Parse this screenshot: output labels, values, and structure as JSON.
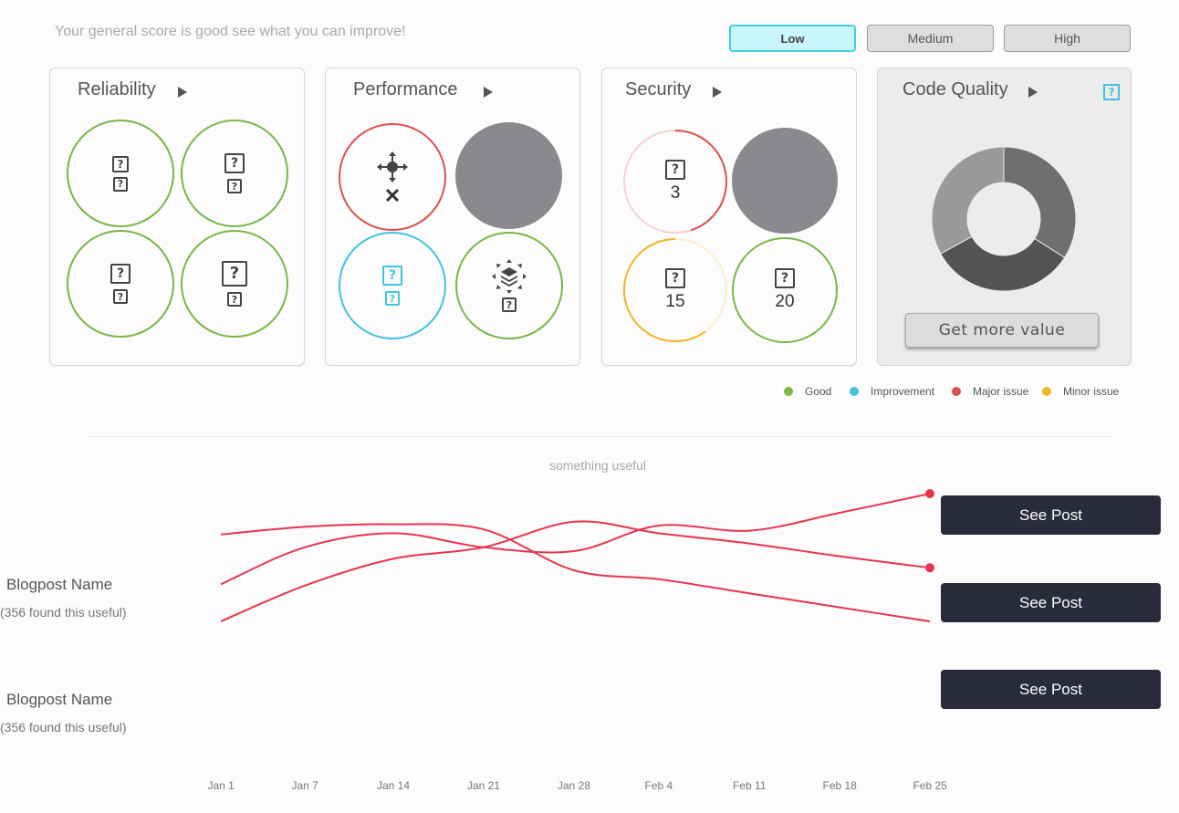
{
  "header": {
    "intro": "Your general score is good see what you can improve!"
  },
  "severity": {
    "options": [
      "Low",
      "Medium",
      "High"
    ],
    "selected": "Low"
  },
  "cards": {
    "reliability": {
      "title": "Reliability",
      "circles": [
        {
          "status": "good",
          "icons": [
            "question-icon",
            "question-icon"
          ]
        },
        {
          "status": "good",
          "icons": [
            "question-icon",
            "question-icon"
          ]
        },
        {
          "status": "good",
          "icons": [
            "question-icon",
            "question-icon"
          ]
        },
        {
          "status": "good",
          "icons": [
            "question-icon",
            "question-icon"
          ]
        }
      ]
    },
    "performance": {
      "title": "Performance",
      "circles": [
        {
          "status": "major",
          "icons": [
            "move-icon",
            "close-icon"
          ]
        },
        {
          "status": "disabled",
          "icons": []
        },
        {
          "status": "improvement",
          "icons": [
            "question-icon",
            "question-icon"
          ]
        },
        {
          "status": "good",
          "icons": [
            "layers-expand-icon",
            "question-icon"
          ]
        }
      ]
    },
    "security": {
      "title": "Security",
      "circles": [
        {
          "status": "major",
          "value": "3",
          "progress": 0.45
        },
        {
          "status": "disabled"
        },
        {
          "status": "minor",
          "value": "15",
          "progress": 0.6
        },
        {
          "status": "good",
          "value": "20",
          "progress": 1
        }
      ]
    },
    "code_quality": {
      "title": "Code Quality",
      "button": "Get more value",
      "help_icon": "?",
      "donut": [
        {
          "share": 0.34,
          "color": "#6f6f6f"
        },
        {
          "share": 0.33,
          "color": "#545454"
        },
        {
          "share": 0.33,
          "color": "#9a9a9a"
        }
      ]
    }
  },
  "legend": [
    {
      "label": "Good",
      "color": "#7ab648"
    },
    {
      "label": "Improvement",
      "color": "#40c4dc"
    },
    {
      "label": "Major issue",
      "color": "#d9534f"
    },
    {
      "label": "Minor issue",
      "color": "#f0b429"
    }
  ],
  "colors": {
    "good": "#7ab648",
    "improvement": "#40c4dc",
    "major": "#d9534f",
    "minor": "#f0b429",
    "disabled": "#8a8a8e",
    "line": "#e8344e"
  },
  "section": {
    "subtitle": "something useful"
  },
  "blogposts": [
    {
      "name": "Blogpost Name",
      "meta": "(356 found this useful)"
    },
    {
      "name": "Blogpost Name",
      "meta": "(356 found this useful)"
    }
  ],
  "see_post": [
    "See Post",
    "See Post",
    "See Post"
  ],
  "chart_data": {
    "type": "line",
    "x": [
      "Jan 1",
      "Jan 7",
      "Jan 14",
      "Jan 21",
      "Jan 28",
      "Feb 4",
      "Feb 11",
      "Feb 18",
      "Feb 25"
    ],
    "series": [
      {
        "values": [
          48,
          54,
          56,
          52,
          20,
          13,
          2,
          -9,
          -20
        ]
      },
      {
        "values": [
          9,
          38,
          49,
          38,
          35,
          55,
          51,
          65,
          80
        ]
      },
      {
        "values": [
          -20,
          8,
          29,
          38,
          58,
          49,
          41,
          31,
          22
        ]
      }
    ]
  }
}
